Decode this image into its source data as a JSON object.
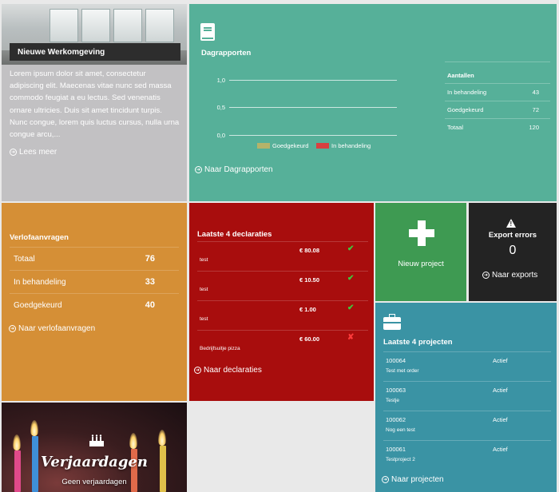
{
  "news": {
    "title": "Nieuwe Werkomgeving",
    "body": "Lorem ipsum dolor sit amet, consectetur adipiscing elit. Maecenas vitae nunc sed massa commodo feugiat a eu lectus. Sed venenatis ornare ultricies. Duis sit amet tincidunt turpis. Nunc congue, lorem quis luctus cursus, nulla urna congue arcu,...",
    "link": "Lees meer"
  },
  "dagrapporten": {
    "title": "Dagrapporten",
    "icon": "book-icon",
    "link": "Naar Dagrapporten",
    "chart_data": {
      "type": "bar",
      "ylim": [
        0,
        1
      ],
      "yticks": [
        "1,0",
        "0,5",
        "0,0"
      ],
      "series": [
        {
          "name": "Goedgekeurd",
          "color": "#b5b36a"
        },
        {
          "name": "In behandeling",
          "color": "#d94040"
        }
      ],
      "grid": true,
      "legend": "bottom"
    },
    "counts": {
      "header": "Aantallen",
      "rows": [
        {
          "label": "In behandeling",
          "value": "43"
        },
        {
          "label": "Goedgekeurd",
          "value": "72"
        },
        {
          "label": "Totaal",
          "value": "120"
        }
      ]
    }
  },
  "verlof": {
    "title": "Verlofaanvragen",
    "rows": [
      {
        "label": "Totaal",
        "value": "76"
      },
      {
        "label": "In behandeling",
        "value": "33"
      },
      {
        "label": "Goedgekeurd",
        "value": "40"
      }
    ],
    "link": "Naar verlofaanvragen"
  },
  "declaraties": {
    "title": "Laatste 4 declaraties",
    "items": [
      {
        "amount": "€ 80.08",
        "desc": "test",
        "status": "✔"
      },
      {
        "amount": "€ 10.50",
        "desc": "test",
        "status": "✔"
      },
      {
        "amount": "€ 1.00",
        "desc": "test",
        "status": "✔"
      },
      {
        "amount": "€ 60.00",
        "desc": "Bedrijfsuitje pizza",
        "status": "✘"
      }
    ],
    "link": "Naar declaraties"
  },
  "nieuw_project": {
    "label": "Nieuw project",
    "icon": "plus-icon"
  },
  "export": {
    "title": "Export errors",
    "count": "0",
    "link": "Naar exports",
    "icon": "warning-icon"
  },
  "projecten": {
    "title": "Laatste 4 projecten",
    "icon": "briefcase-icon",
    "items": [
      {
        "number": "100064",
        "name": "Test met order",
        "status": "Actief"
      },
      {
        "number": "100063",
        "name": "Testje",
        "status": "Actief"
      },
      {
        "number": "100062",
        "name": "Nog een test",
        "status": "Actief"
      },
      {
        "number": "100061",
        "name": "Testproject 2",
        "status": "Actief"
      }
    ],
    "link": "Naar projecten"
  },
  "verjaardagen": {
    "title": "Verjaardagen",
    "subtitle": "Geen verjaardagen"
  },
  "colors": {
    "green_tile": "#56b099",
    "orange_tile": "#d58f36",
    "red_tile": "#a80d0d",
    "project_green": "#3e9a52",
    "dark_tile": "#232323",
    "blue_tile": "#3a93a4"
  }
}
